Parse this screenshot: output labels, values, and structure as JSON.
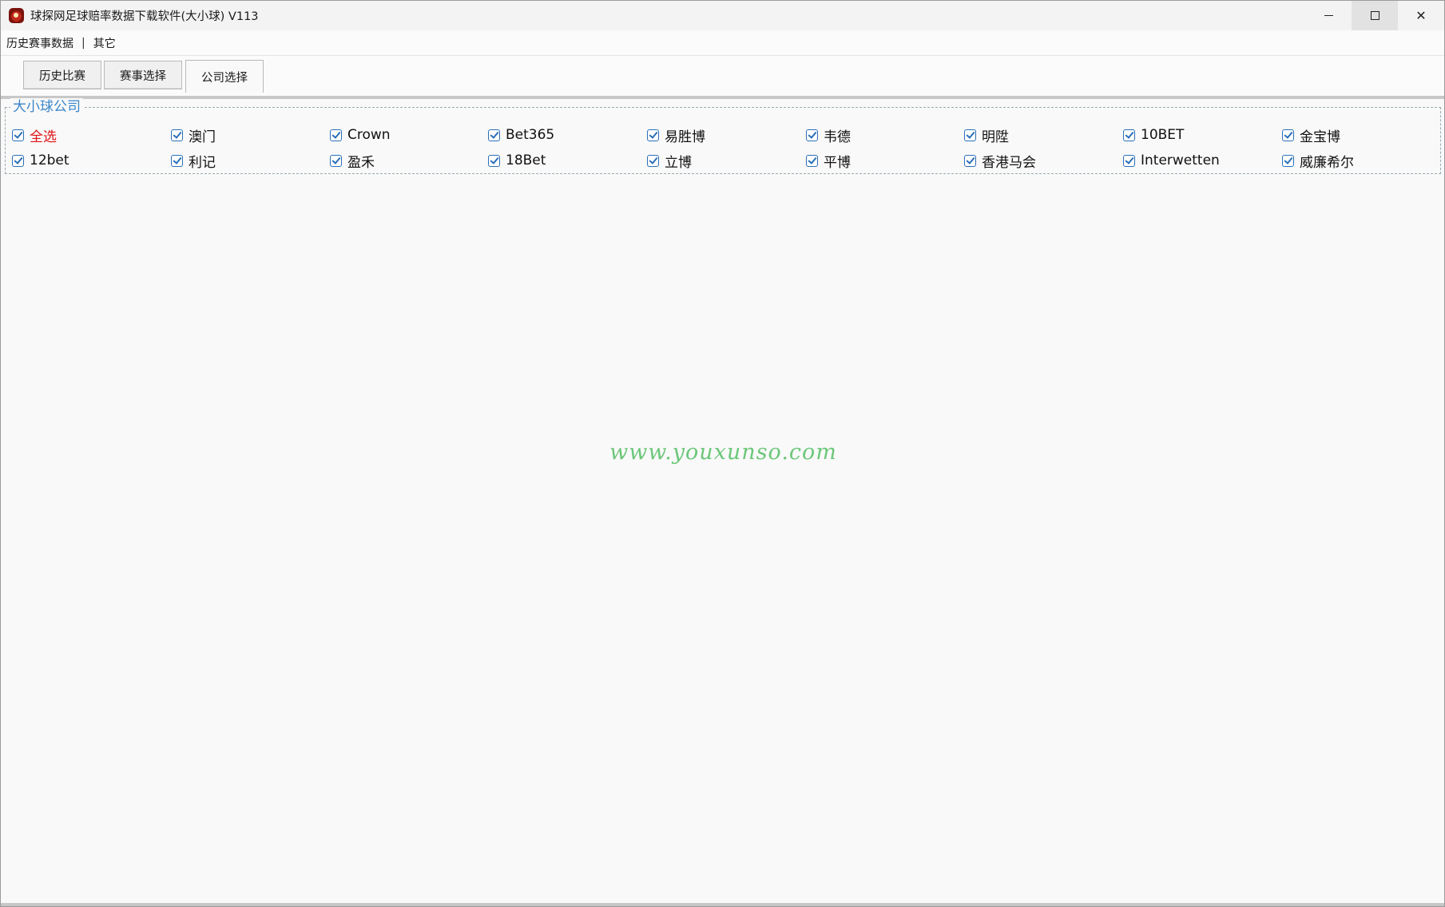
{
  "window": {
    "title": "球探网足球赔率数据下载软件(大小球) V113",
    "controls": {
      "minimize": "—",
      "maximize": "☐",
      "close": "✕"
    }
  },
  "menu": {
    "items": [
      "历史赛事数据",
      "其它"
    ],
    "separator": "|"
  },
  "tabs": [
    {
      "label": "历史比赛",
      "active": false
    },
    {
      "label": "赛事选择",
      "active": false
    },
    {
      "label": "公司选择",
      "active": true
    }
  ],
  "group": {
    "title": "大小球公司",
    "checkboxes": [
      {
        "label": "全选",
        "checked": true,
        "highlight": true
      },
      {
        "label": "澳门",
        "checked": true
      },
      {
        "label": "Crown",
        "checked": true
      },
      {
        "label": "Bet365",
        "checked": true
      },
      {
        "label": "易胜博",
        "checked": true
      },
      {
        "label": "韦德",
        "checked": true
      },
      {
        "label": "明陞",
        "checked": true
      },
      {
        "label": "10BET",
        "checked": true
      },
      {
        "label": "金宝博",
        "checked": true
      },
      {
        "label": "12bet",
        "checked": true
      },
      {
        "label": "利记",
        "checked": true
      },
      {
        "label": "盈禾",
        "checked": true
      },
      {
        "label": "18Bet",
        "checked": true
      },
      {
        "label": "立博",
        "checked": true
      },
      {
        "label": "平博",
        "checked": true
      },
      {
        "label": "香港马会",
        "checked": true
      },
      {
        "label": "Interwetten",
        "checked": true
      },
      {
        "label": "威廉希尔",
        "checked": true
      }
    ]
  },
  "watermark": "www.youxunso.com",
  "colors": {
    "accent": "#3a86c8",
    "checkbox": "#2a6fb8",
    "select_all_label": "#e01414",
    "watermark": "#6cc77a"
  }
}
